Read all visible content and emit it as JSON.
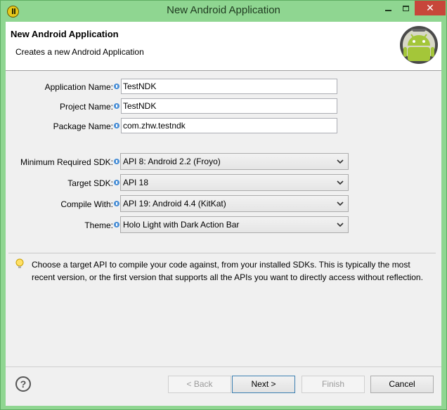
{
  "window": {
    "title": "New Android Application"
  },
  "banner": {
    "title": "New Android Application",
    "subtitle": "Creates a new Android Application"
  },
  "form": {
    "app_name": {
      "label": "Application Name:",
      "value": "TestNDK"
    },
    "project_name": {
      "label": "Project Name:",
      "value": "TestNDK"
    },
    "package_name": {
      "label": "Package Name:",
      "value": "com.zhw.testndk"
    },
    "min_sdk": {
      "label": "Minimum Required SDK:",
      "value": "API 8: Android 2.2 (Froyo)"
    },
    "target_sdk": {
      "label": "Target SDK:",
      "value": "API 18"
    },
    "compile_with": {
      "label": "Compile With:",
      "value": "API 19: Android 4.4 (KitKat)"
    },
    "theme": {
      "label": "Theme:",
      "value": "Holo Light with Dark Action Bar"
    }
  },
  "help": {
    "text": "Choose a target API to compile your code against, from your installed SDKs. This is typically the most recent version, or the first version that supports all the APIs you want to directly access without reflection."
  },
  "buttons": {
    "back": "< Back",
    "next": "Next >",
    "finish": "Finish",
    "cancel": "Cancel"
  },
  "colors": {
    "window_frame": "#8fd691",
    "close_button": "#c7463a",
    "android_green": "#a4c639"
  }
}
